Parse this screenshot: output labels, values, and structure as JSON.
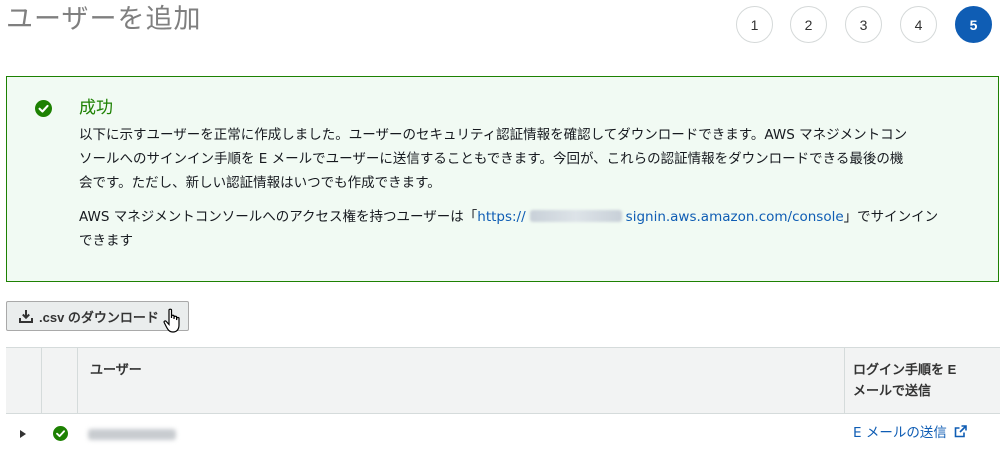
{
  "page": {
    "title": "ユーザーを追加"
  },
  "steps": [
    {
      "label": "1",
      "active": false
    },
    {
      "label": "2",
      "active": false
    },
    {
      "label": "3",
      "active": false
    },
    {
      "label": "4",
      "active": false
    },
    {
      "label": "5",
      "active": true
    }
  ],
  "alert": {
    "type": "success",
    "title": "成功",
    "body_line1": "以下に示すユーザーを正常に作成しました。ユーザーのセキュリティ認証情報を確認してダウンロードできます。AWS マネジメントコン",
    "body_line2": "ソールへのサインイン手順を E メールでユーザーに送信することもできます。今回が、これらの認証情報をダウンロードできる最後の機",
    "body_line3": "会です。ただし、新しい認証情報はいつでも作成できます。",
    "signin_prefix": "AWS マネジメントコンソールへのアクセス権を持つユーザーは「",
    "signin_url_start": "https://",
    "signin_url_end": "signin.aws.amazon.com/console",
    "signin_suffix": "」でサインイン",
    "signin_line2": "できます",
    "color": "#1d8102"
  },
  "download_button": {
    "label": ".csv のダウンロード",
    "icon": "download-icon"
  },
  "table": {
    "columns": [
      "",
      "",
      "ユーザー",
      "ログイン手順を E メールで送信"
    ],
    "column4_line1": "ログイン手順を E",
    "column4_line2": "メールで送信",
    "rows": [
      {
        "status": "success",
        "user": "",
        "send_label": "E メールの送信",
        "send_icon": "external-link-icon"
      }
    ]
  },
  "colors": {
    "accent": "#0f5db4",
    "success": "#1d8102"
  }
}
